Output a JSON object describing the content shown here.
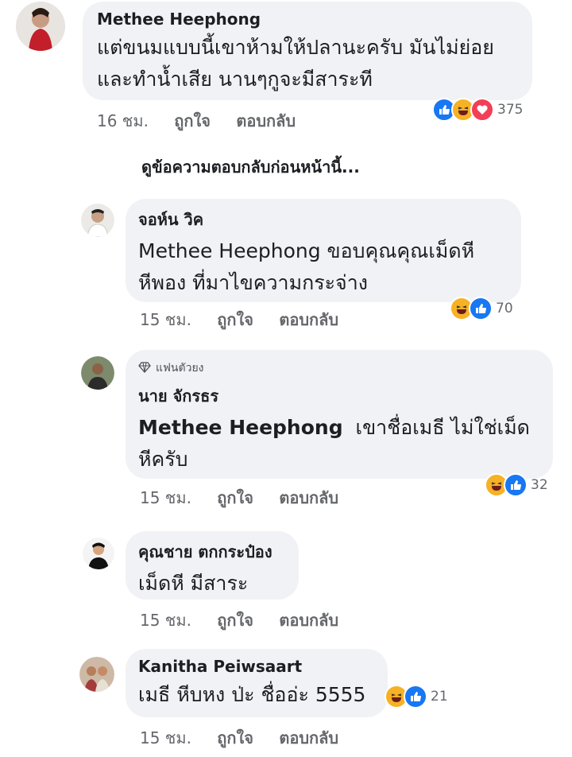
{
  "comments": [
    {
      "author": "Methee Heephong",
      "line1": "แต่ขนมแบบนี้เขาห้ามให้ปลานะครับ มันไม่ย่อย",
      "line2": "และทำน้ำเสีย นานๆกูจะมีสาระที",
      "time": "16 ชม.",
      "like": "ถูกใจ",
      "reply": "ตอบกลับ",
      "reactions": [
        "like",
        "haha",
        "love"
      ],
      "count": "375"
    },
    {
      "author": "จอห์น วิค",
      "line1": "Methee Heephong ขอบคุณคุณเม็ดหี",
      "line2": "หีพอง ที่มาไขความกระจ่าง",
      "time": "15 ชม.",
      "like": "ถูกใจ",
      "reply": "ตอบกลับ",
      "reactions": [
        "haha",
        "like"
      ],
      "count": "70"
    },
    {
      "badge": "แฟนตัวยง",
      "author": "นาย จักรธร",
      "mention": "Methee Heephong",
      "line1": "เขาชื่อเมธี ไม่ใช่เม็ด",
      "line2": "หีครับ",
      "time": "15 ชม.",
      "like": "ถูกใจ",
      "reply": "ตอบกลับ",
      "reactions": [
        "haha",
        "like"
      ],
      "count": "32"
    },
    {
      "author": "คุณชาย ตกกระป๋อง",
      "line1": "เม็ดหี มีสาระ",
      "time": "15 ชม.",
      "like": "ถูกใจ",
      "reply": "ตอบกลับ"
    },
    {
      "author": "Kanitha Peiwsaart",
      "line1": "เมธี หีบหง ป่ะ ชื่ออ่ะ 5555",
      "time": "15 ชม.",
      "like": "ถูกใจ",
      "reply": "ตอบกลับ",
      "reactions": [
        "haha",
        "like"
      ],
      "count": "21"
    }
  ],
  "view_previous": "ดูข้อความตอบกลับก่อนหน้านี้...",
  "icons": {
    "like": "thumbs-up-icon",
    "haha": "laughing-face-icon",
    "love": "heart-icon",
    "badge": "diamond-icon"
  },
  "colors": {
    "like": "#1877f2",
    "haha": "#f7b125",
    "love": "#f33e58",
    "bubble": "#f0f2f5"
  }
}
